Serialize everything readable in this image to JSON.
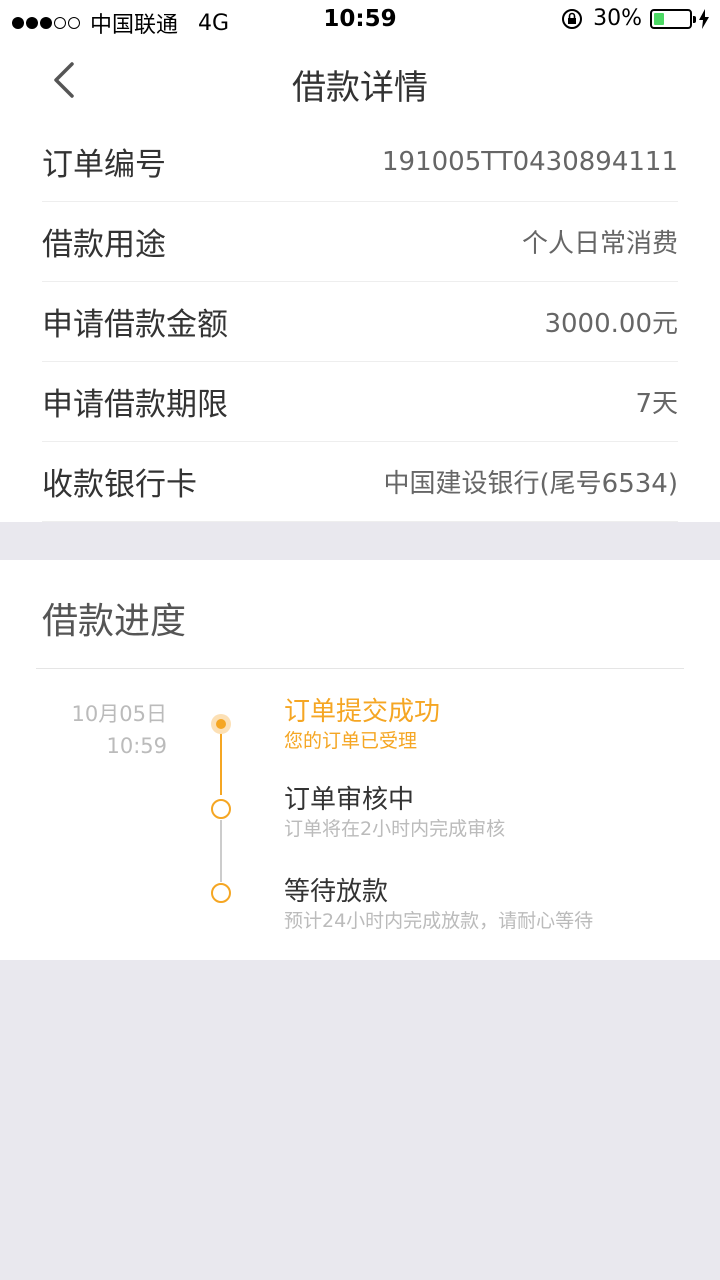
{
  "status_bar": {
    "carrier": "中国联通",
    "network": "4G",
    "time": "10:59",
    "battery": "30%",
    "battery_level": 0.3,
    "signal_bars_filled": 3,
    "signal_bars_total": 5
  },
  "nav": {
    "title": "借款详情",
    "back_icon": "chevron-left-icon"
  },
  "details": [
    {
      "label": "订单编号",
      "value": "191005TT0430894111"
    },
    {
      "label": "借款用途",
      "value": "个人日常消费"
    },
    {
      "label": "申请借款金额",
      "value": "3000.00元"
    },
    {
      "label": "申请借款期限",
      "value": "7天"
    },
    {
      "label": "收款银行卡",
      "value": "中国建设银行(尾号6534)"
    }
  ],
  "progress": {
    "title": "借款进度",
    "date": "10月05日",
    "time": "10:59",
    "steps": [
      {
        "title": "订单提交成功",
        "desc": "您的订单已受理",
        "state": "done"
      },
      {
        "title": "订单审核中",
        "desc": "订单将在2小时内完成审核",
        "state": "pending"
      },
      {
        "title": "等待放款",
        "desc": "预计24小时内完成放款，请耐心等待",
        "state": "pending"
      }
    ]
  },
  "colors": {
    "accent": "#f5a623",
    "muted": "#bbbbbb",
    "background": "#e9e8ee",
    "battery": "#4cd964"
  }
}
